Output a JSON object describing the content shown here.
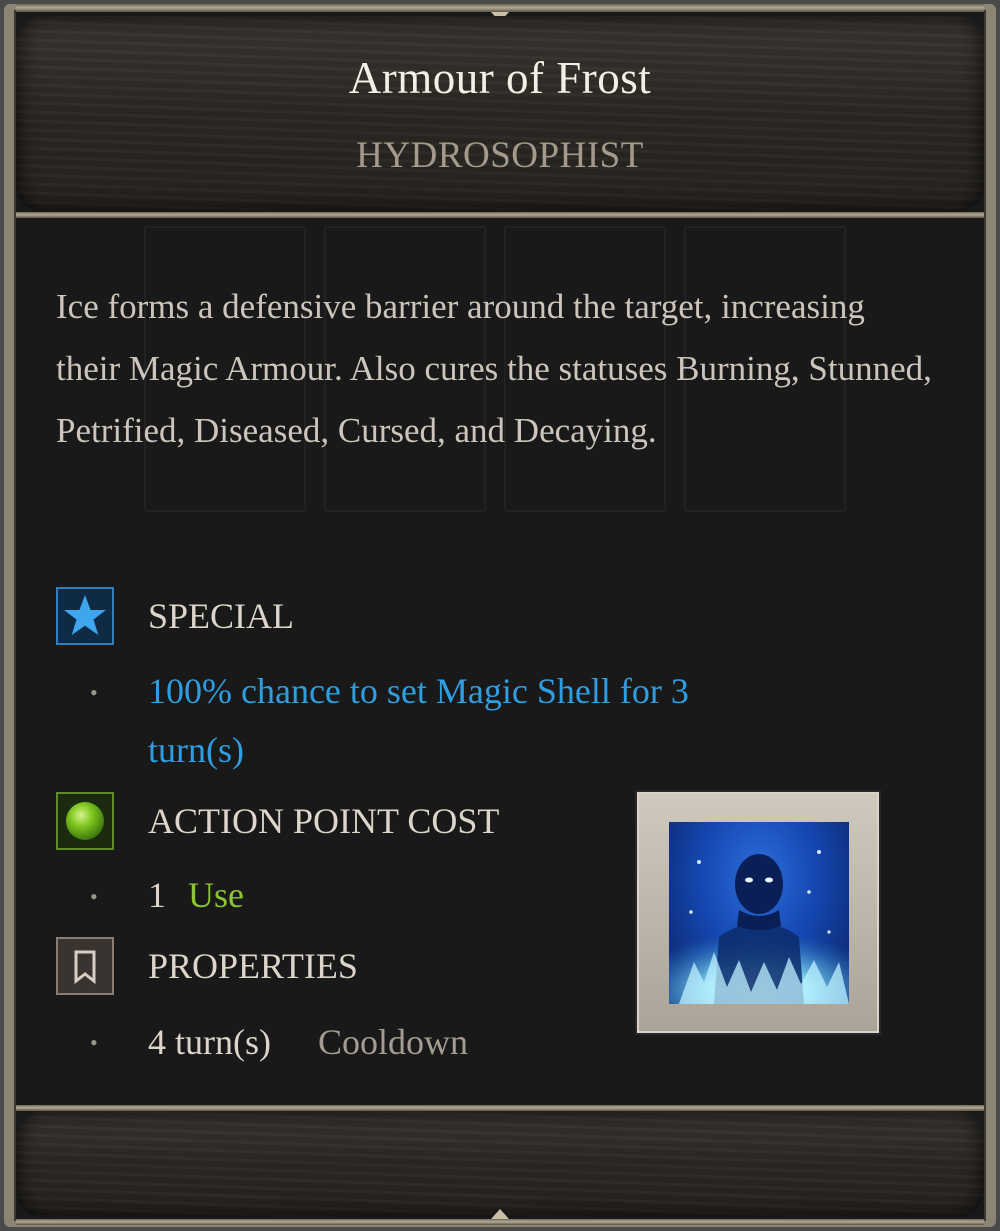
{
  "tooltip": {
    "title": "Armour of Frost",
    "school": "HYDROSOPHIST",
    "description": "Ice forms a defensive barrier around the target, increasing their Magic Armour. Also cures the statuses Burning, Stunned, Petrified, Diseased, Cursed, and Decaying.",
    "sections": {
      "special": {
        "label": "SPECIAL",
        "icon": "star-icon",
        "line1": "100% chance to set Magic Shell for 3",
        "line2": "turn(s)",
        "color": "#2f9ee0"
      },
      "action_point_cost": {
        "label": "ACTION POINT COST",
        "icon": "green-orb-icon",
        "value": "1",
        "unit": "Use",
        "color": "#8cc432"
      },
      "properties": {
        "label": "PROPERTIES",
        "icon": "bookmark-icon",
        "value": "4 turn(s)",
        "unit": "Cooldown"
      }
    },
    "skill_icon": "frost-figure-icon"
  }
}
